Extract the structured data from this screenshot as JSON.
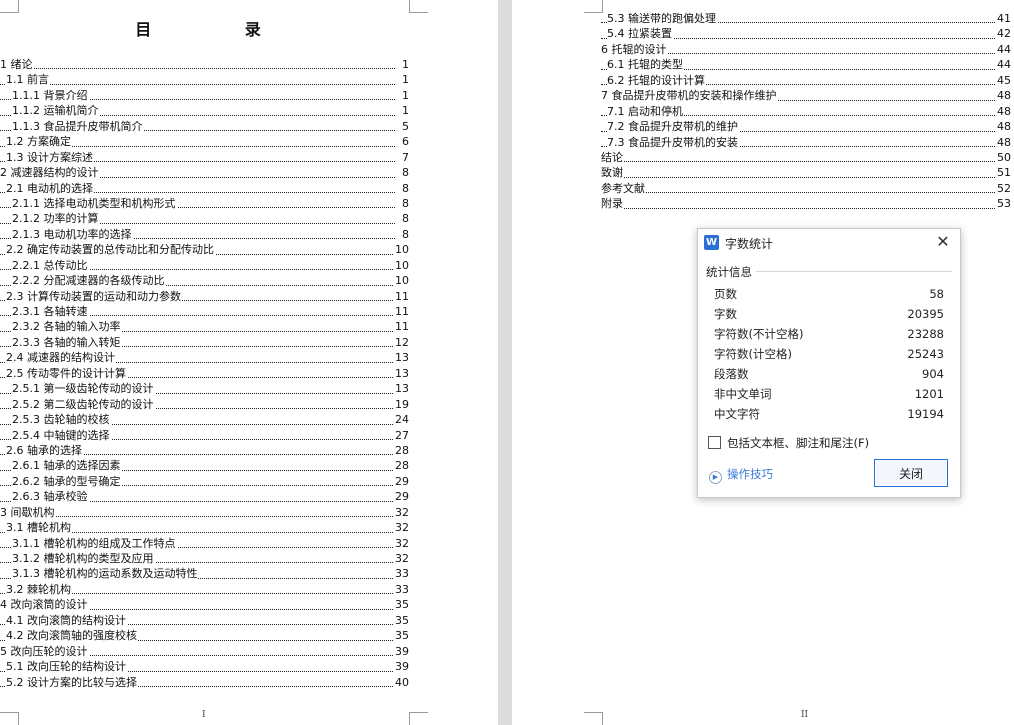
{
  "page1": {
    "title": "目    录",
    "footer": "I",
    "toc": [
      {
        "text": "1 绪论",
        "page": "1",
        "indent": 0
      },
      {
        "text": "1.1 前言",
        "page": "1",
        "indent": 1
      },
      {
        "text": "1.1.1 背景介绍",
        "page": "1",
        "indent": 2
      },
      {
        "text": "1.1.2 运输机简介",
        "page": "1",
        "indent": 2
      },
      {
        "text": "1.1.3 食品提升皮带机简介",
        "page": "5",
        "indent": 2
      },
      {
        "text": "1.2 方案确定",
        "page": "6",
        "indent": 1
      },
      {
        "text": "1.3 设计方案综述",
        "page": "7",
        "indent": 1
      },
      {
        "text": "2 减速器结构的设计",
        "page": "8",
        "indent": 0
      },
      {
        "text": "2.1 电动机的选择",
        "page": "8",
        "indent": 1
      },
      {
        "text": "2.1.1 选择电动机类型和机构形式",
        "page": "8",
        "indent": 2
      },
      {
        "text": "2.1.2 功率的计算",
        "page": "8",
        "indent": 2
      },
      {
        "text": "2.1.3 电动机功率的选择",
        "page": "8",
        "indent": 2
      },
      {
        "text": "2.2 确定传动装置的总传动比和分配传动比",
        "page": "10",
        "indent": 1
      },
      {
        "text": "2.2.1 总传动比",
        "page": "10",
        "indent": 2
      },
      {
        "text": "2.2.2 分配减速器的各级传动比",
        "page": "10",
        "indent": 2
      },
      {
        "text": "2.3 计算传动装置的运动和动力参数",
        "page": "11",
        "indent": 1
      },
      {
        "text": "2.3.1 各轴转速",
        "page": "11",
        "indent": 2
      },
      {
        "text": "2.3.2 各轴的输入功率",
        "page": "11",
        "indent": 2
      },
      {
        "text": "2.3.3 各轴的输入转矩",
        "page": "12",
        "indent": 2
      },
      {
        "text": "2.4 减速器的结构设计",
        "page": "13",
        "indent": 1
      },
      {
        "text": "2.5 传动零件的设计计算",
        "page": "13",
        "indent": 1
      },
      {
        "text": "2.5.1 第一级齿轮传动的设计",
        "page": "13",
        "indent": 2
      },
      {
        "text": "2.5.2 第二级齿轮传动的设计",
        "page": "19",
        "indent": 2
      },
      {
        "text": "2.5.3 齿轮轴的校核",
        "page": "24",
        "indent": 2
      },
      {
        "text": "2.5.4 中轴键的选择",
        "page": "27",
        "indent": 2
      },
      {
        "text": "2.6 轴承的选择",
        "page": "28",
        "indent": 1
      },
      {
        "text": "2.6.1 轴承的选择因素",
        "page": "28",
        "indent": 2
      },
      {
        "text": "2.6.2 轴承的型号确定",
        "page": "29",
        "indent": 2
      },
      {
        "text": "2.6.3 轴承校验",
        "page": "29",
        "indent": 2
      },
      {
        "text": "3 间歇机构",
        "page": "32",
        "indent": 0
      },
      {
        "text": "3.1 槽轮机构",
        "page": "32",
        "indent": 1
      },
      {
        "text": "3.1.1 槽轮机构的组成及工作特点",
        "page": "32",
        "indent": 2
      },
      {
        "text": "3.1.2 槽轮机构的类型及应用",
        "page": "32",
        "indent": 2
      },
      {
        "text": "3.1.3 槽轮机构的运动系数及运动特性",
        "page": "33",
        "indent": 2
      },
      {
        "text": "3.2 棘轮机构",
        "page": "33",
        "indent": 1
      },
      {
        "text": "4 改向滚筒的设计",
        "page": "35",
        "indent": 0
      },
      {
        "text": "4.1 改向滚筒的结构设计",
        "page": "35",
        "indent": 1
      },
      {
        "text": "4.2 改向滚筒轴的强度校核",
        "page": "35",
        "indent": 1
      },
      {
        "text": "5 改向压轮的设计",
        "page": "39",
        "indent": 0
      },
      {
        "text": "5.1 改向压轮的结构设计",
        "page": "39",
        "indent": 1
      },
      {
        "text": "5.2 设计方案的比较与选择",
        "page": "40",
        "indent": 1
      }
    ]
  },
  "page2": {
    "footer": "II",
    "toc": [
      {
        "text": "5.3 输送带的跑偏处理",
        "page": "41",
        "indent": 1
      },
      {
        "text": "5.4 拉紧装置",
        "page": "42",
        "indent": 1
      },
      {
        "text": "6 托辊的设计",
        "page": "44",
        "indent": 0
      },
      {
        "text": "6.1 托辊的类型",
        "page": "44",
        "indent": 1
      },
      {
        "text": "6.2 托辊的设计计算",
        "page": "45",
        "indent": 1
      },
      {
        "text": "7 食品提升皮带机的安装和操作维护",
        "page": "48",
        "indent": 0
      },
      {
        "text": "7.1 启动和停机",
        "page": "48",
        "indent": 1
      },
      {
        "text": "7.2 食品提升皮带机的维护",
        "page": "48",
        "indent": 1
      },
      {
        "text": "7.3 食品提升皮带机的安装",
        "page": "48",
        "indent": 1
      },
      {
        "text": "结论",
        "page": "50",
        "indent": 0
      },
      {
        "text": "致谢",
        "page": "51",
        "indent": 0
      },
      {
        "text": "参考文献",
        "page": "52",
        "indent": 0
      },
      {
        "text": "附录",
        "page": "53",
        "indent": 0
      }
    ]
  },
  "dialog": {
    "icon_letter": "W",
    "title": "字数统计",
    "group_label": "统计信息",
    "stats": [
      {
        "label": "页数",
        "value": "58"
      },
      {
        "label": "字数",
        "value": "20395"
      },
      {
        "label": "字符数(不计空格)",
        "value": "23288"
      },
      {
        "label": "字符数(计空格)",
        "value": "25243"
      },
      {
        "label": "段落数",
        "value": "904"
      },
      {
        "label": "非中文单词",
        "value": "1201"
      },
      {
        "label": "中文字符",
        "value": "19194"
      }
    ],
    "checkbox_label": "包括文本框、脚注和尾注(F)",
    "checkbox_checked": false,
    "tips_label": "操作技巧",
    "close_button": "关闭",
    "close_icon": "close-icon"
  }
}
